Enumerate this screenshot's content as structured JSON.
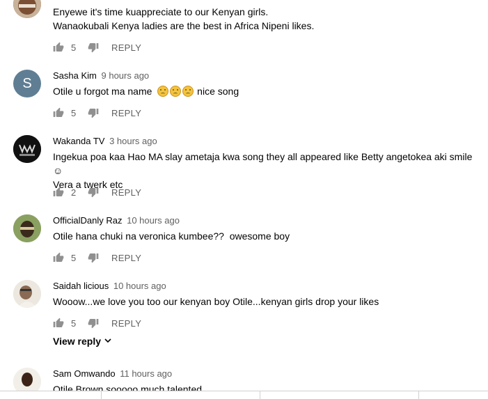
{
  "comments": [
    {
      "author": "",
      "time": "",
      "lines": [
        "Enyewe it's time kuappreciate to our Kenyan girls.",
        "Wanaokubali Kenya ladies are the best in Africa Nipeni likes."
      ],
      "likes": "5",
      "reply_label": "REPLY",
      "avatar": "avatar-photo"
    },
    {
      "author": "Sasha Kim",
      "time": "9 hours ago",
      "text_before": "Otile u forgot ma name",
      "emoji_count": 3,
      "emoji": "disappointed-face",
      "text_after": " nice song",
      "likes": "5",
      "reply_label": "REPLY",
      "avatar_letter": "S"
    },
    {
      "author": "Wakanda TV",
      "time": "3 hours ago",
      "lines": [
        "Ingekua poa kaa Hao MA slay ametaja kwa song they all appeared like Betty angetokea aki smile ☺",
        "Vera a twerk etc"
      ],
      "likes": "2",
      "reply_label": "REPLY",
      "avatar": "wakanda-logo"
    },
    {
      "author": "OfficialDanly Raz",
      "time": "10 hours ago",
      "lines": [
        "Otile hana chuki na veronica kumbee??  owesome boy"
      ],
      "likes": "5",
      "reply_label": "REPLY",
      "avatar": "avatar-photo"
    },
    {
      "author": "Saidah licious",
      "time": "10 hours ago",
      "lines": [
        "Wooow...we love you too our kenyan boy Otile...kenyan girls drop your likes"
      ],
      "likes": "5",
      "reply_label": "REPLY",
      "view_reply": "View reply",
      "avatar": "avatar-photo"
    },
    {
      "author": "Sam Omwando",
      "time": "11 hours ago",
      "lines": [
        "Otile Brown sooooo much talented"
      ],
      "avatar": "avatar-photo"
    }
  ],
  "colors": {
    "avatar_letter_bg": "#5f7e94",
    "meta": "#606060",
    "text": "#030303"
  },
  "icons": {
    "like": "thumbs-up-icon",
    "dislike": "thumbs-down-icon",
    "expand": "chevron-down-icon"
  }
}
